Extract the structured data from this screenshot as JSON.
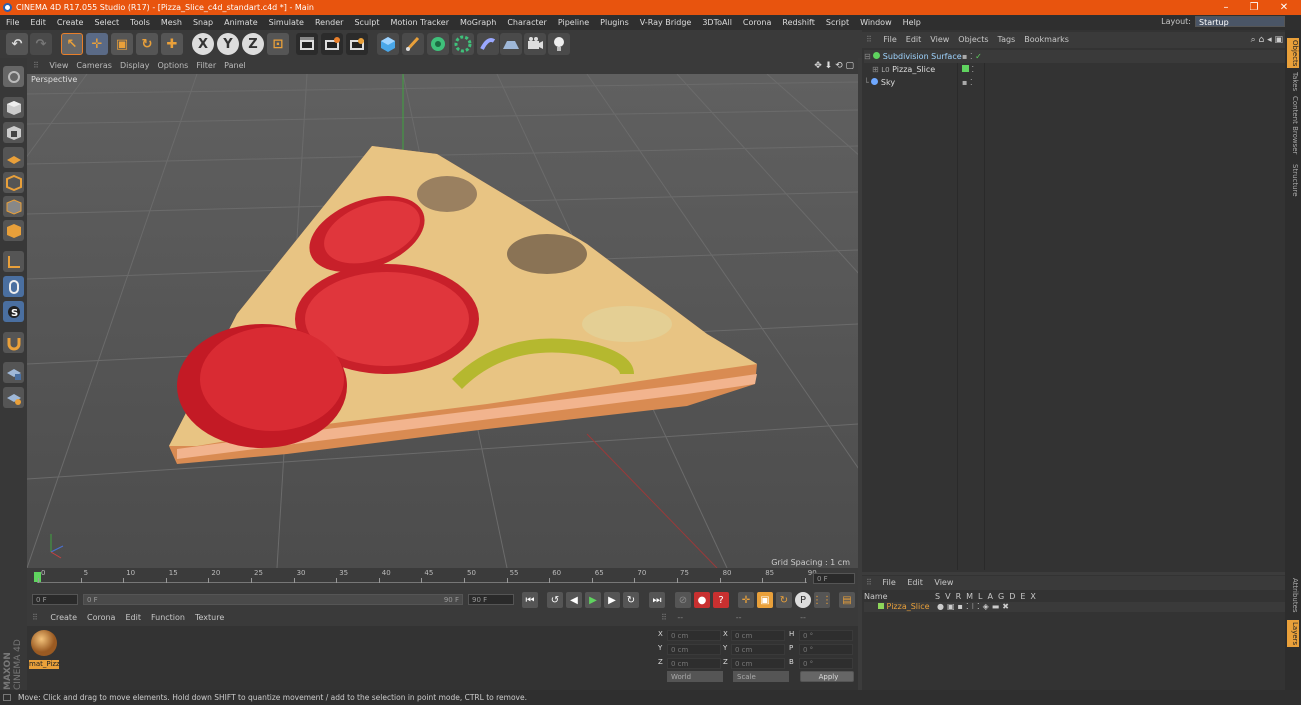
{
  "window": {
    "title": "CINEMA 4D R17.055 Studio (R17) - [Pizza_Slice_c4d_standart.c4d *] - Main",
    "minimize": "–",
    "restore": "❐",
    "close": "✕"
  },
  "menu": [
    "File",
    "Edit",
    "Create",
    "Select",
    "Tools",
    "Mesh",
    "Snap",
    "Animate",
    "Simulate",
    "Render",
    "Sculpt",
    "Motion Tracker",
    "MoGraph",
    "Character",
    "Pipeline",
    "Plugins",
    "V-Ray Bridge",
    "3DToAll",
    "Corona",
    "Redshift",
    "Script",
    "Window",
    "Help"
  ],
  "layout": {
    "label": "Layout:",
    "value": "Startup"
  },
  "toolbar": {
    "undo": "↶",
    "redo": "↷",
    "select": "↖",
    "move": "✛",
    "scale": "▣",
    "rotate": "↻",
    "transform": "✚",
    "x": "X",
    "y": "Y",
    "z": "Z",
    "coord": "⊡"
  },
  "viewport": {
    "menus": [
      "View",
      "Cameras",
      "Display",
      "Options",
      "Filter",
      "Panel"
    ],
    "label": "Perspective",
    "grid_spacing": "Grid Spacing : 1 cm"
  },
  "timeline": {
    "ticks": [
      "0",
      "5",
      "10",
      "15",
      "20",
      "25",
      "30",
      "35",
      "40",
      "45",
      "50",
      "55",
      "60",
      "65",
      "70",
      "75",
      "80",
      "85",
      "90"
    ],
    "current": "0 F"
  },
  "playbar": {
    "start": "0 F",
    "slider_left": "0 F",
    "slider_right": "90 F",
    "end": "90 F"
  },
  "material_panel": {
    "menus": [
      "Create",
      "Corona",
      "Edit",
      "Function",
      "Texture"
    ],
    "material_name": "mat_Pizz"
  },
  "coords": {
    "rows": [
      {
        "a": "X",
        "av": "0 cm",
        "b": "X",
        "bv": "0 cm",
        "c": "H",
        "cv": "0 °"
      },
      {
        "a": "Y",
        "av": "0 cm",
        "b": "Y",
        "bv": "0 cm",
        "c": "P",
        "cv": "0 °"
      },
      {
        "a": "Z",
        "av": "0 cm",
        "b": "Z",
        "bv": "0 cm",
        "c": "B",
        "cv": "0 °"
      }
    ],
    "world": "World",
    "scale": "Scale",
    "apply": "Apply",
    "dash1": "--",
    "dash2": "--",
    "dash3": "--"
  },
  "object_panel": {
    "menus": [
      "File",
      "Edit",
      "View",
      "Objects",
      "Tags",
      "Bookmarks"
    ],
    "objects": [
      {
        "name": "Subdivision Surface",
        "color": "#5fd35f"
      },
      {
        "name": "Pizza_Slice",
        "color": "#5fd35f"
      },
      {
        "name": "Sky",
        "color": "#6fa8ff"
      }
    ]
  },
  "layer_panel": {
    "menus": [
      "File",
      "Edit",
      "View"
    ],
    "header_name": "Name",
    "columns": [
      "S",
      "V",
      "R",
      "M",
      "L",
      "A",
      "G",
      "D",
      "E",
      "X"
    ],
    "layer_name": "Pizza_Slice",
    "layer_color": "#8dd65a"
  },
  "right_tabs": [
    "Objects",
    "Takes",
    "Content Browser",
    "Structure"
  ],
  "right_tabs_bottom": [
    "Attributes",
    "Layers"
  ],
  "status": "Move: Click and drag to move elements. Hold down SHIFT to quantize movement / add to the selection in point mode, CTRL to remove.",
  "brand": {
    "maxon": "MAXON",
    "c4d": "CINEMA 4D"
  },
  "colors": {
    "title_bg": "#e8540e",
    "accent": "#e9a03a",
    "selection": "#4a5566"
  }
}
